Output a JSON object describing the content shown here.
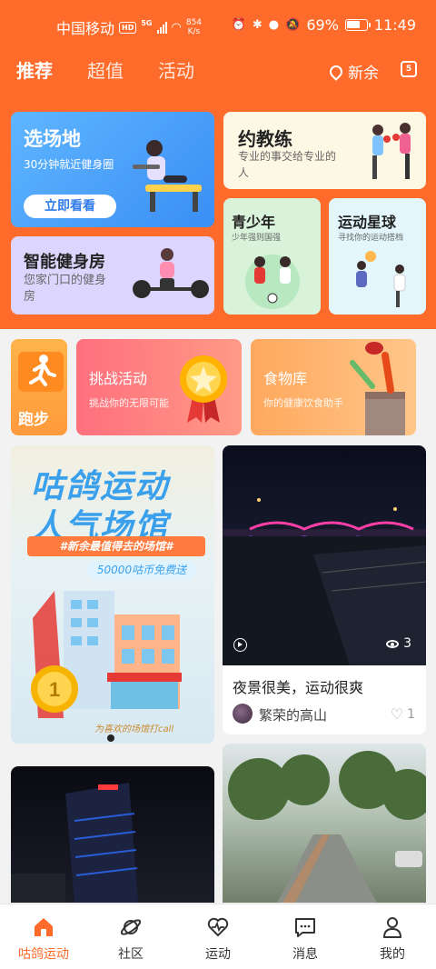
{
  "status_bar": {
    "carrier": "中国移动",
    "hd": "HD",
    "network": "5G",
    "speed_value": "854",
    "speed_unit": "K/s",
    "battery": "69%",
    "time": "11:49"
  },
  "header": {
    "tabs": [
      {
        "label": "推荐",
        "active": true
      },
      {
        "label": "超值",
        "active": false
      },
      {
        "label": "活动",
        "active": false
      }
    ],
    "location": "新余",
    "calendar_icon": "calendar-icon"
  },
  "feature_cards": {
    "venue": {
      "title": "选场地",
      "subtitle": "30分钟就近健身圈",
      "button": "立即看看"
    },
    "coach": {
      "title": "约教练",
      "subtitle": "专业的事交给专业的人"
    },
    "gym": {
      "title": "智能健身房",
      "subtitle": "您家门口的健身房"
    },
    "youth": {
      "title": "青少年",
      "subtitle": "少年强则国强"
    },
    "star": {
      "title": "运动星球",
      "subtitle": "寻找你的运动搭档"
    }
  },
  "quick_cards": {
    "run": {
      "label": "跑步"
    },
    "challenge": {
      "title": "挑战活动",
      "subtitle": "挑战你的无限可能"
    },
    "food": {
      "title": "食物库",
      "subtitle": "你的健康饮食助手"
    }
  },
  "banner": {
    "title_line1": "咕鸽运动",
    "title_line2": "人气场馆",
    "tag": "#新余最值得去的场馆#",
    "promo": "50000咕币免费送",
    "footer": "为喜欢的场馆打call"
  },
  "post": {
    "views": "3",
    "title": "夜景很美，运动很爽",
    "author": "繁荣的高山",
    "likes": "1"
  },
  "bottom_nav": [
    {
      "label": "咕鸽运动",
      "icon": "home-icon",
      "active": true
    },
    {
      "label": "社区",
      "icon": "planet-icon",
      "active": false
    },
    {
      "label": "运动",
      "icon": "heartbeat-icon",
      "active": false
    },
    {
      "label": "消息",
      "icon": "message-icon",
      "active": false
    },
    {
      "label": "我的",
      "icon": "user-icon",
      "active": false
    }
  ],
  "colors": {
    "brand": "#ff6b2b",
    "active_tab": "#ff6b2b"
  }
}
